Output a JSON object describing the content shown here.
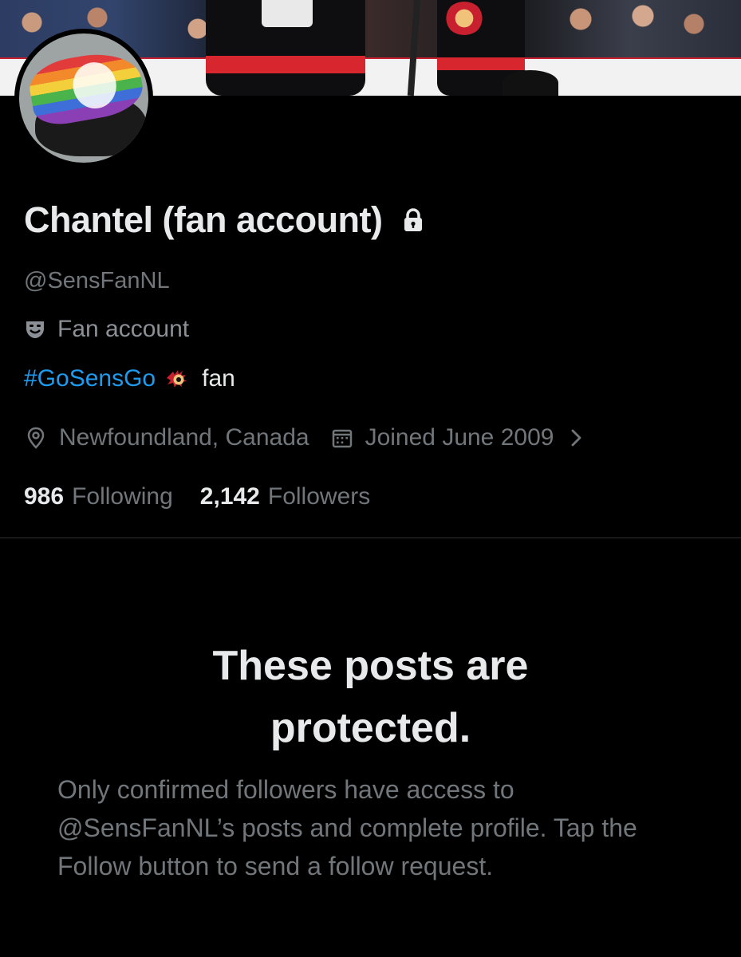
{
  "profile": {
    "display_name": "Chantel (fan account)",
    "handle": "@SensFanNL",
    "badge": {
      "icon": "theater-masks-icon",
      "label": "Fan account"
    },
    "bio": {
      "hashtag": "#GoSensGo",
      "emoji": "senators-logo-icon",
      "text": "fan"
    },
    "location": "Newfoundland, Canada",
    "joined": "Joined June 2009",
    "following_count": "986",
    "following_label": "Following",
    "followers_count": "2,142",
    "followers_label": "Followers"
  },
  "protected": {
    "title_line1": "These posts are",
    "title_line2": "protected.",
    "description": "Only confirmed followers have access to @SensFanNL’s posts and complete profile. Tap the Follow button to send a follow request."
  },
  "colors": {
    "background": "#000000",
    "text_primary": "#e7e9ea",
    "text_secondary": "#71767b",
    "link": "#1d9bf0",
    "divider": "#2f3336"
  }
}
